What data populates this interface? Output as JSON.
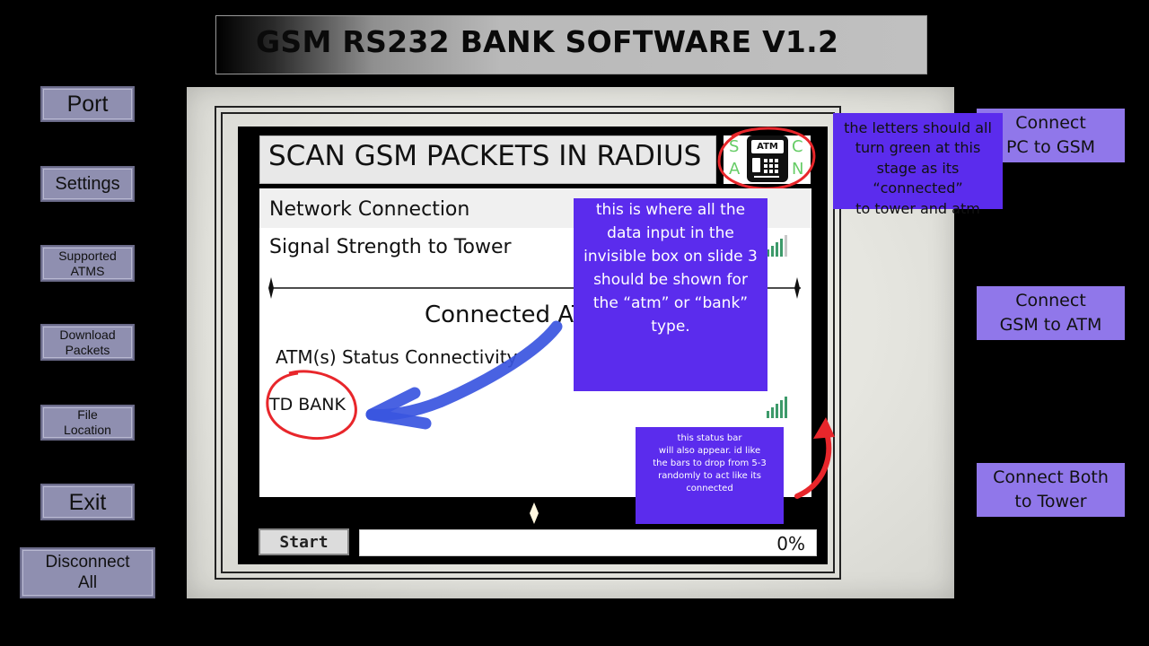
{
  "title": "GSM RS232 BANK SOFTWARE V1.2",
  "sidebar": {
    "port": "Port",
    "settings": "Settings",
    "supported_atms": "Supported\nATMS",
    "download_packets": "Download\nPackets",
    "file_location": "File\nLocation",
    "exit": "Exit",
    "disconnect_all": "Disconnect\nAll"
  },
  "panel": {
    "scan_title": "SCAN GSM PACKETS IN RADIUS",
    "logo": {
      "letters": [
        "S",
        "A",
        "C",
        "N"
      ],
      "badge": "ATM"
    },
    "network_connection": "Network Connection",
    "signal_strength": "Signal Strength to Tower",
    "connected_heading": "Connected AT",
    "atm_status": "ATM(s) Status Connectivity",
    "bank_name": "TD BANK",
    "start_label": "Start",
    "progress_text": "0%",
    "progress_value": 0
  },
  "right_buttons": {
    "pc_to_gsm": "Connect\nPC to GSM",
    "gsm_to_atm": "Connect\nGSM to ATM",
    "both_to_tower": "Connect Both\nto Tower"
  },
  "notes": {
    "letters_note": "the letters should all\nturn green at this\nstage as its “connected”\nto tower and atm",
    "data_note": "this is where all the\ndata input in the\ninvisible box on slide 3\nshould be shown for\nthe “atm” or “bank”\ntype.",
    "status_note": "this status bar\nwill also appear. id like\nthe bars to drop from 5-3\nrandomly to act like its\nconnected"
  },
  "colors": {
    "accent_purple": "#5b2ced",
    "button_purple": "#9077ea",
    "sidebar_button": "#8f8fb0",
    "signal_green": "#3d9a6a",
    "annotation_red": "#e8262b",
    "arrow_blue": "#3a55e0"
  }
}
